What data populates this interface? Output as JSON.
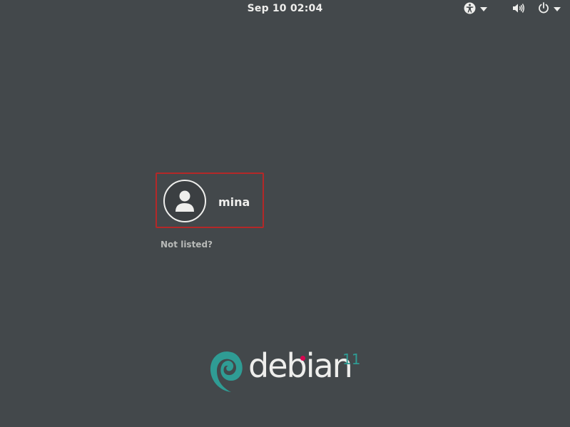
{
  "topbar": {
    "clock": "Sep 10  02:04",
    "a11y_icon": "accessibility-icon",
    "sound_icon": "volume-icon",
    "power_icon": "power-icon",
    "dropdown_icon": "chevron-down-icon"
  },
  "login": {
    "users": [
      {
        "name": "mina",
        "avatar_icon": "user-avatar-icon"
      }
    ],
    "not_listed": "Not listed?",
    "selection_color": "#b42828"
  },
  "branding": {
    "word": "debian",
    "version": "11",
    "logo_icon": "debian-swirl-icon",
    "accent": "#d70751",
    "swirl_color": "#2f9c94"
  },
  "colors": {
    "background": "#43484b",
    "text": "#eeeeec"
  }
}
